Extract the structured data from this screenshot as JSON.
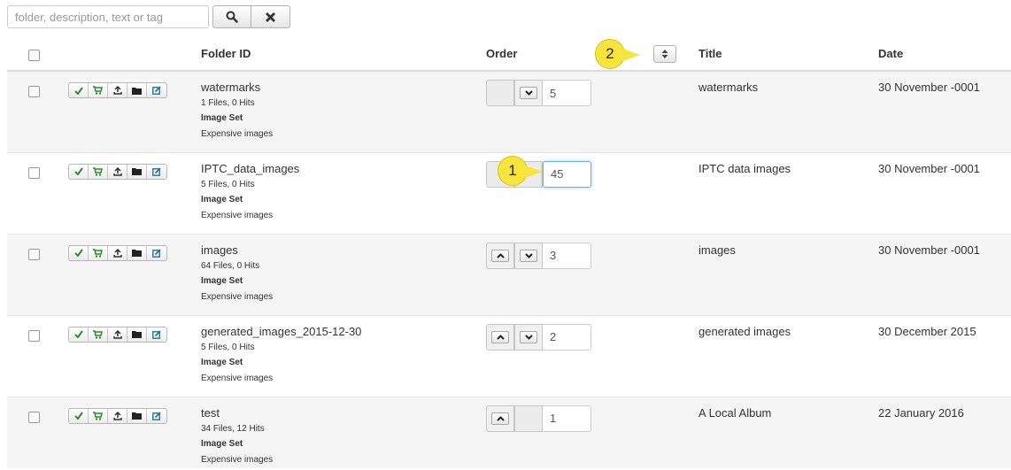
{
  "search": {
    "placeholder": "folder, description, text or tag"
  },
  "toolbar": {
    "search_button_icon": "search-icon",
    "clear_button_icon": "close-icon"
  },
  "header": {
    "folder_id": "Folder ID",
    "order": "Order",
    "title": "Title",
    "date": "Date"
  },
  "callouts": {
    "one": "1",
    "two": "2"
  },
  "colors": {
    "accent_green": "#2e8b2e",
    "callout": "#f7e53b",
    "focus": "#66afe9"
  },
  "rows": [
    {
      "folder": "watermarks",
      "meta": "1 Files, 0 Hits",
      "set": "Image Set",
      "desc": "Expensive images",
      "order": "5",
      "title": "watermarks",
      "date": "30 November -0001"
    },
    {
      "folder": "IPTC_data_images",
      "meta": "5 Files, 0 Hits",
      "set": "Image Set",
      "desc": "Expensive images",
      "order": "45",
      "title": "IPTC data images",
      "date": "30 November -0001"
    },
    {
      "folder": "images",
      "meta": "64 Files, 0 Hits",
      "set": "Image Set",
      "desc": "Expensive images",
      "order": "3",
      "title": "images",
      "date": "30 November -0001"
    },
    {
      "folder": "generated_images_2015-12-30",
      "meta": "5 Files, 0 Hits",
      "set": "Image Set",
      "desc": "Expensive images",
      "order": "2",
      "title": "generated images",
      "date": "30 December 2015"
    },
    {
      "folder": "test",
      "meta": "34 Files, 12 Hits",
      "set": "Image Set",
      "desc": "Expensive images",
      "order": "1",
      "title": "A Local Album",
      "date": "22 January 2016"
    }
  ]
}
